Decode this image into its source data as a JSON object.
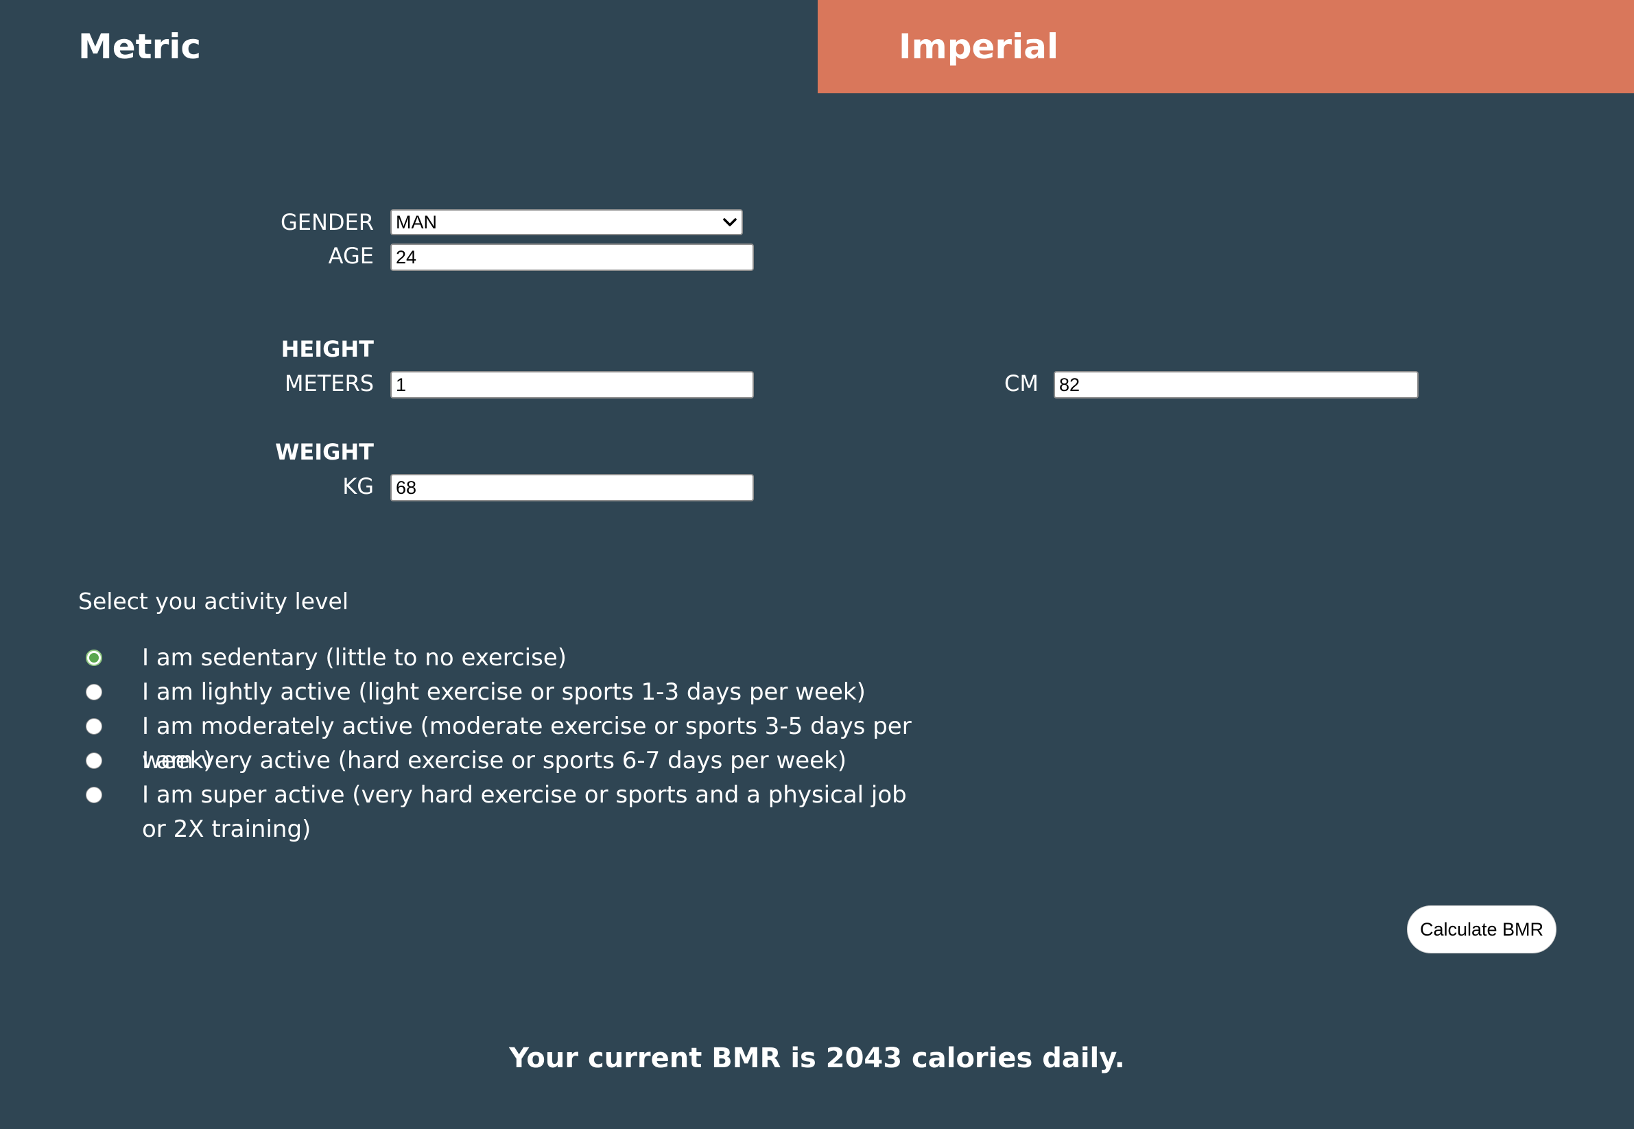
{
  "tabs": {
    "metric": "Metric",
    "imperial": "Imperial"
  },
  "colors": {
    "background": "#2f4553",
    "active_tab": "#d9775b",
    "radio_selected": "#5aa64e"
  },
  "form": {
    "gender_label": "GENDER",
    "gender_value": "MAN",
    "age_label": "AGE",
    "age_value": "24",
    "height_heading": "HEIGHT",
    "meters_label": "METERS",
    "meters_value": "1",
    "cm_label": "CM",
    "cm_value": "82",
    "weight_heading": "WEIGHT",
    "kg_label": "KG",
    "kg_value": "68"
  },
  "activity": {
    "title": "Select you activity level",
    "options": [
      {
        "label": "I am sedentary (little to no exercise)",
        "selected": true
      },
      {
        "label": "I am lightly active (light exercise or sports 1-3 days per week)",
        "selected": false
      },
      {
        "label": "I am moderately active (moderate exercise or sports 3-5 days per week)",
        "selected": false
      },
      {
        "label": "I am very active (hard exercise or sports 6-7 days per week)",
        "selected": false
      },
      {
        "label": "I am super active (very hard exercise or sports and a physical job or 2X training)",
        "selected": false
      }
    ]
  },
  "calculate_button": "Calculate BMR",
  "result_text": "Your current BMR is 2043 calories daily.",
  "icons": {
    "dropdown": "chevron-down-icon"
  }
}
